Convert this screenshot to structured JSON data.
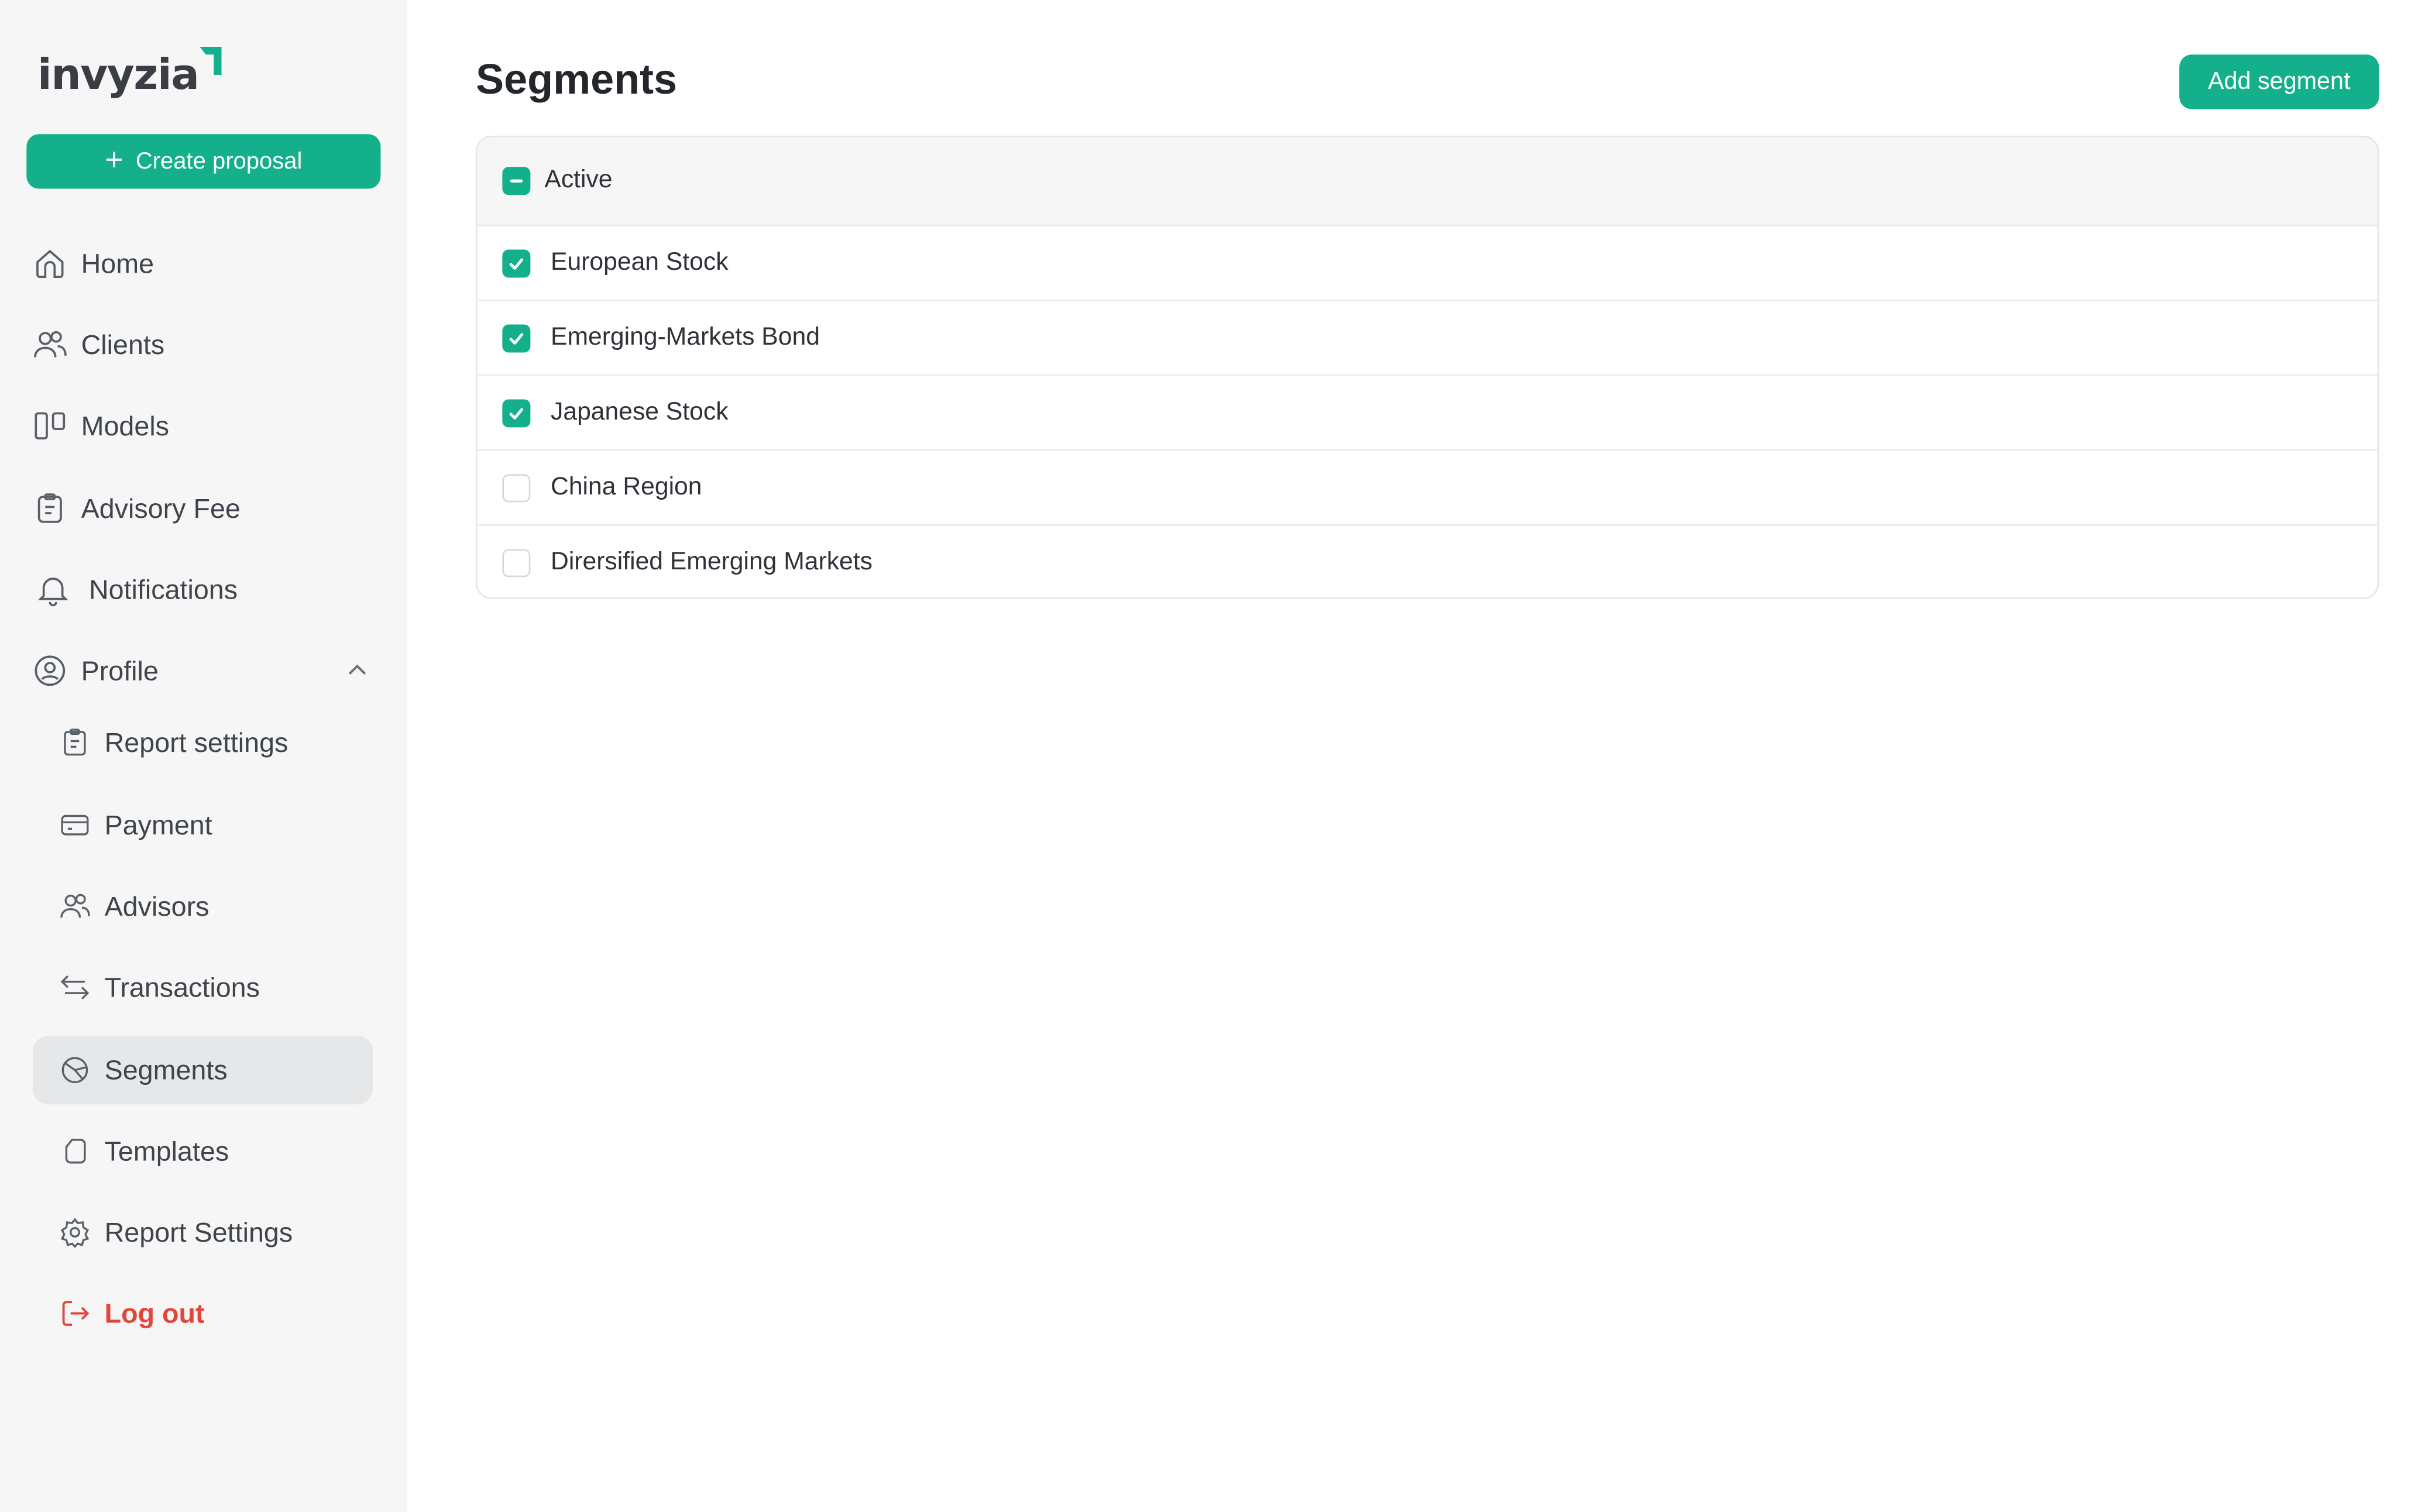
{
  "brand": {
    "name": "invyzia",
    "accent": "#14b08b",
    "danger": "#e3453a"
  },
  "sidebar": {
    "create_label": "Create proposal",
    "items": [
      {
        "label": "Home",
        "icon": "home-icon"
      },
      {
        "label": "Clients",
        "icon": "users-icon"
      },
      {
        "label": "Models",
        "icon": "columns-icon"
      },
      {
        "label": "Advisory Fee",
        "icon": "clipboard-icon"
      },
      {
        "label": "Notifications",
        "icon": "bell-icon"
      },
      {
        "label": "Profile",
        "icon": "user-circle-icon",
        "expanded": true
      }
    ],
    "sub_items": [
      {
        "label": "Report settings",
        "icon": "clipboard-icon"
      },
      {
        "label": "Payment",
        "icon": "credit-card-icon"
      },
      {
        "label": "Advisors",
        "icon": "users-icon"
      },
      {
        "label": "Transactions",
        "icon": "arrows-swap-icon"
      },
      {
        "label": "Segments",
        "icon": "pie-chart-icon",
        "active": true
      },
      {
        "label": "Templates",
        "icon": "document-icon"
      },
      {
        "label": "Report Settings",
        "icon": "gear-icon"
      }
    ],
    "logout_label": "Log out"
  },
  "main": {
    "title": "Segments",
    "add_label": "Add segment",
    "group": {
      "label": "Active",
      "state": "indeterminate",
      "rows": [
        {
          "label": "European Stock",
          "checked": true
        },
        {
          "label": "Emerging-Markets Bond",
          "checked": true
        },
        {
          "label": "Japanese Stock",
          "checked": true
        },
        {
          "label": "China Region",
          "checked": false
        },
        {
          "label": "Dirersified Emerging Markets",
          "checked": false
        }
      ]
    }
  }
}
